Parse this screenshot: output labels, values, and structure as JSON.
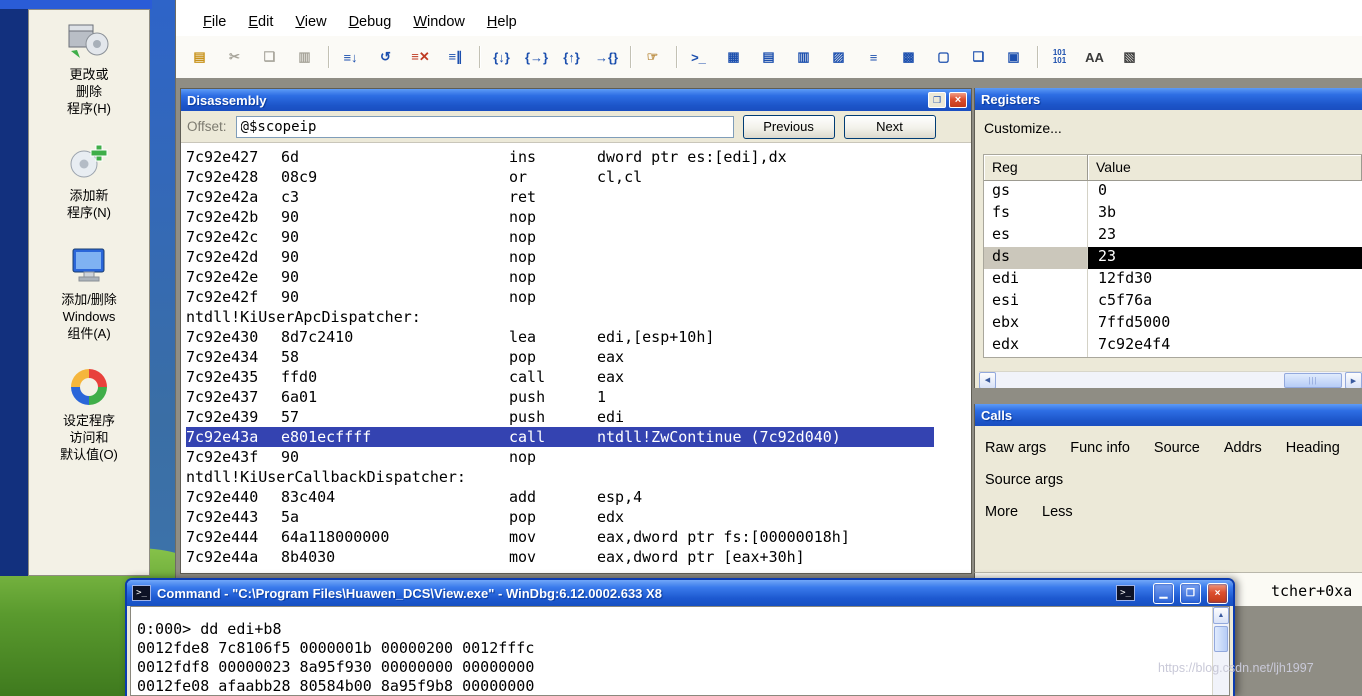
{
  "desktop": {
    "sidebar_items": [
      {
        "label": "更改或\n删除\n程序(H)"
      },
      {
        "label": "添加新\n程序(N)"
      },
      {
        "label": "添加/删除\nWindows\n组件(A)"
      },
      {
        "label": "设定程序\n访问和\n默认值(O)"
      }
    ]
  },
  "menu": {
    "items": [
      "File",
      "Edit",
      "View",
      "Debug",
      "Window",
      "Help"
    ]
  },
  "toolbar": {
    "icons": [
      {
        "name": "open-source-file",
        "glyph": "▤",
        "tone": "gold"
      },
      {
        "name": "cut",
        "glyph": "✂",
        "tone": "dim"
      },
      {
        "name": "copy",
        "glyph": "❏",
        "tone": "dim"
      },
      {
        "name": "paste",
        "glyph": "▥",
        "tone": "dim"
      },
      {
        "sep": true
      },
      {
        "name": "go",
        "glyph": "≡↓",
        "tone": "blue"
      },
      {
        "name": "restart",
        "glyph": "↺",
        "tone": "blue"
      },
      {
        "name": "stop-debugging",
        "glyph": "≡✕",
        "tone": "red"
      },
      {
        "name": "break",
        "glyph": "≡∥",
        "tone": "blue"
      },
      {
        "sep": true
      },
      {
        "name": "step-into",
        "glyph": "{↓}",
        "tone": "blue"
      },
      {
        "name": "step-over",
        "glyph": "{→}",
        "tone": "blue"
      },
      {
        "name": "step-out",
        "glyph": "{↑}",
        "tone": "blue"
      },
      {
        "name": "run-to-cursor",
        "glyph": "→{}",
        "tone": "blue"
      },
      {
        "sep": true
      },
      {
        "name": "breakpoint-hand",
        "glyph": "☞",
        "tone": "tan"
      },
      {
        "sep": true
      },
      {
        "name": "command-window",
        "glyph": ">_",
        "tone": "blue"
      },
      {
        "name": "watch-window",
        "glyph": "▦",
        "tone": "blue"
      },
      {
        "name": "locals-window",
        "glyph": "▤",
        "tone": "blue"
      },
      {
        "name": "registers-window",
        "glyph": "▥",
        "tone": "blue"
      },
      {
        "name": "memory-window",
        "glyph": "▨",
        "tone": "blue"
      },
      {
        "name": "call-stack-window",
        "glyph": "≡",
        "tone": "blue"
      },
      {
        "name": "disassembly-window",
        "glyph": "▩",
        "tone": "blue"
      },
      {
        "name": "scratch-pad-window",
        "glyph": "▢",
        "tone": "blue"
      },
      {
        "name": "processes-window",
        "glyph": "❏",
        "tone": "blue"
      },
      {
        "name": "modules-window",
        "glyph": "▣",
        "tone": "blue"
      },
      {
        "sep": true
      },
      {
        "name": "memory-101",
        "glyph": "101\n101",
        "tone": "num"
      },
      {
        "name": "font",
        "glyph": "AA",
        "tone": "dark"
      },
      {
        "name": "options",
        "glyph": "▧",
        "tone": "dark"
      }
    ]
  },
  "disassembly": {
    "title": "Disassembly",
    "offset_label": "Offset:",
    "offset_value": "@$scopeip",
    "previous_button": "Previous",
    "next_button": "Next",
    "lines": [
      {
        "addr": "7c92e427",
        "bytes": "6d",
        "mn": "ins",
        "ops": "dword ptr es:[edi],dx"
      },
      {
        "addr": "7c92e428",
        "bytes": "08c9",
        "mn": "or",
        "ops": "cl,cl"
      },
      {
        "addr": "7c92e42a",
        "bytes": "c3",
        "mn": "ret",
        "ops": ""
      },
      {
        "addr": "7c92e42b",
        "bytes": "90",
        "mn": "nop",
        "ops": ""
      },
      {
        "addr": "7c92e42c",
        "bytes": "90",
        "mn": "nop",
        "ops": ""
      },
      {
        "addr": "7c92e42d",
        "bytes": "90",
        "mn": "nop",
        "ops": ""
      },
      {
        "addr": "7c92e42e",
        "bytes": "90",
        "mn": "nop",
        "ops": ""
      },
      {
        "addr": "7c92e42f",
        "bytes": "90",
        "mn": "nop",
        "ops": ""
      },
      {
        "label": "ntdll!KiUserApcDispatcher:"
      },
      {
        "addr": "7c92e430",
        "bytes": "8d7c2410",
        "mn": "lea",
        "ops": "edi,[esp+10h]"
      },
      {
        "addr": "7c92e434",
        "bytes": "58",
        "mn": "pop",
        "ops": "eax"
      },
      {
        "addr": "7c92e435",
        "bytes": "ffd0",
        "mn": "call",
        "ops": "eax"
      },
      {
        "addr": "7c92e437",
        "bytes": "6a01",
        "mn": "push",
        "ops": "1"
      },
      {
        "addr": "7c92e439",
        "bytes": "57",
        "mn": "push",
        "ops": "edi"
      },
      {
        "addr": "7c92e43a",
        "bytes": "e801ecffff",
        "mn": "call",
        "ops": "ntdll!ZwContinue (7c92d040)",
        "highlight": true
      },
      {
        "addr": "7c92e43f",
        "bytes": "90",
        "mn": "nop",
        "ops": ""
      },
      {
        "label": "ntdll!KiUserCallbackDispatcher:"
      },
      {
        "addr": "7c92e440",
        "bytes": "83c404",
        "mn": "add",
        "ops": "esp,4"
      },
      {
        "addr": "7c92e443",
        "bytes": "5a",
        "mn": "pop",
        "ops": "edx"
      },
      {
        "addr": "7c92e444",
        "bytes": "64a118000000",
        "mn": "mov",
        "ops": "eax,dword ptr fs:[00000018h]"
      },
      {
        "addr": "7c92e44a",
        "bytes": "8b4030",
        "mn": "mov",
        "ops": "eax,dword ptr [eax+30h]"
      }
    ]
  },
  "registers": {
    "title": "Registers",
    "customize_label": "Customize...",
    "columns": [
      "Reg",
      "Value"
    ],
    "selected_reg": "ds",
    "rows": [
      {
        "reg": "gs",
        "value": "0"
      },
      {
        "reg": "fs",
        "value": "3b"
      },
      {
        "reg": "es",
        "value": "23"
      },
      {
        "reg": "ds",
        "value": "23"
      },
      {
        "reg": "edi",
        "value": "12fd30"
      },
      {
        "reg": "esi",
        "value": "c5f76a"
      },
      {
        "reg": "ebx",
        "value": "7ffd5000"
      },
      {
        "reg": "edx",
        "value": "7c92e4f4"
      }
    ]
  },
  "calls": {
    "title": "Calls",
    "buttons_row1": [
      "Raw args",
      "Func info",
      "Source",
      "Addrs",
      "Heading"
    ],
    "buttons_row2": [
      "Source args"
    ],
    "buttons_row3": [
      "More",
      "Less"
    ],
    "visible_fragment": "tcher+0xa"
  },
  "command": {
    "title": "Command - \"C:\\Program Files\\Huawen_DCS\\View.exe\" - WinDbg:6.12.0002.633 X8",
    "lines": [
      "0:000> dd edi+b8",
      "0012fde8  7c8106f5 0000001b 00000200 0012fffc",
      "0012fdf8  00000023 8a95f930 00000000 00000000",
      "0012fe08  afaabb28 80584b00 8a95f9b8 00000000"
    ]
  },
  "watermark": "https://blog.csdn.net/ljh1997"
}
